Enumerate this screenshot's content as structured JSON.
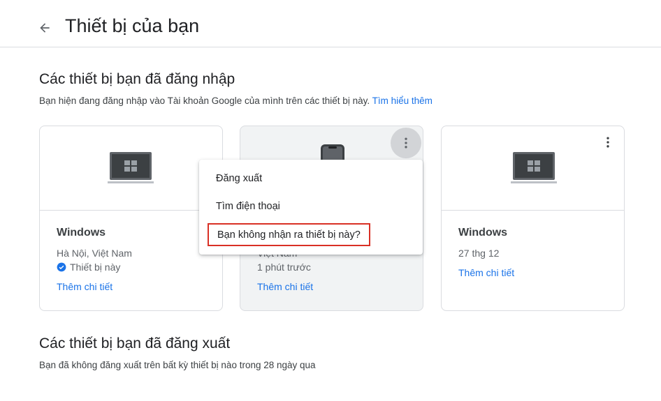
{
  "header": {
    "title": "Thiết bị của bạn",
    "back_icon": "arrow-back-icon"
  },
  "signed_in": {
    "title": "Các thiết bị bạn đã đăng nhập",
    "description": "Bạn hiện đang đăng nhập vào Tài khoản Google của mình trên các thiết bị này.",
    "learn_more": "Tìm hiểu thêm"
  },
  "devices": [
    {
      "name": "Windows",
      "location": "Hà Nội, Việt Nam",
      "status": "Thiết bị này",
      "status_icon": "check-circle-icon",
      "details_link": "Thêm chi tiết",
      "icon": "laptop-icon"
    },
    {
      "name_partial": "Việt Nam",
      "time": "1 phút trước",
      "details_link": "Thêm chi tiết",
      "icon": "phone-icon"
    },
    {
      "name": "Windows",
      "date": "27 thg 12",
      "details_link": "Thêm chi tiết",
      "icon": "laptop-icon"
    }
  ],
  "menu": {
    "items": [
      "Đăng xuất",
      "Tìm điện thoại",
      "Bạn không nhận ra thiết bị này?"
    ],
    "highlight_color": "#d93025"
  },
  "signed_out": {
    "title": "Các thiết bị bạn đã đăng xuất",
    "description": "Bạn đã không đăng xuất trên bất kỳ thiết bị nào trong 28 ngày qua"
  },
  "colors": {
    "link": "#1a73e8",
    "check": "#1a73e8",
    "border": "#dadce0"
  }
}
